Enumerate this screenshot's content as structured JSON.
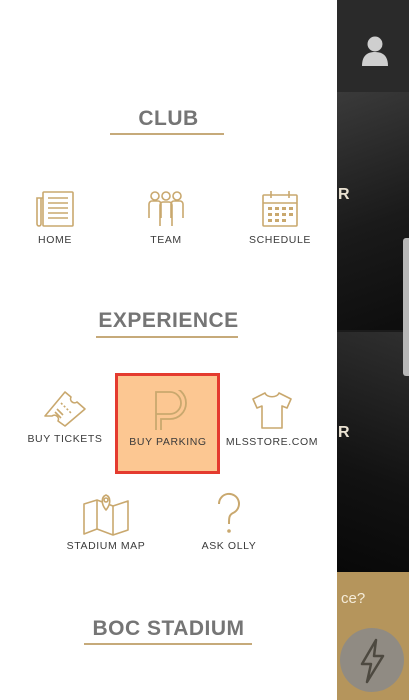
{
  "sections": {
    "club": {
      "title": "CLUB",
      "items": [
        {
          "label": "HOME",
          "icon": "news-icon"
        },
        {
          "label": "TEAM",
          "icon": "team-icon"
        },
        {
          "label": "SCHEDULE",
          "icon": "calendar-icon"
        }
      ]
    },
    "experience": {
      "title": "EXPERIENCE",
      "items": [
        {
          "label": "BUY TICKETS",
          "icon": "ticket-icon"
        },
        {
          "label": "BUY PARKING",
          "icon": "parking-icon"
        },
        {
          "label": "MLSSTORE.COM",
          "icon": "shirt-icon"
        },
        {
          "label": "STADIUM MAP",
          "icon": "map-icon"
        },
        {
          "label": "ASK OLLY",
          "icon": "question-icon"
        }
      ]
    },
    "stadium": {
      "title": "BOC STADIUM"
    }
  },
  "background": {
    "letter_1": "R",
    "letter_2": "R",
    "bottom_text": "ce?"
  },
  "colors": {
    "accent": "#c6aa7a",
    "icon": "#c9a86e",
    "highlight_fill": "#fcc792",
    "highlight_border": "#e43b2f",
    "text": "#3a3a3a"
  }
}
